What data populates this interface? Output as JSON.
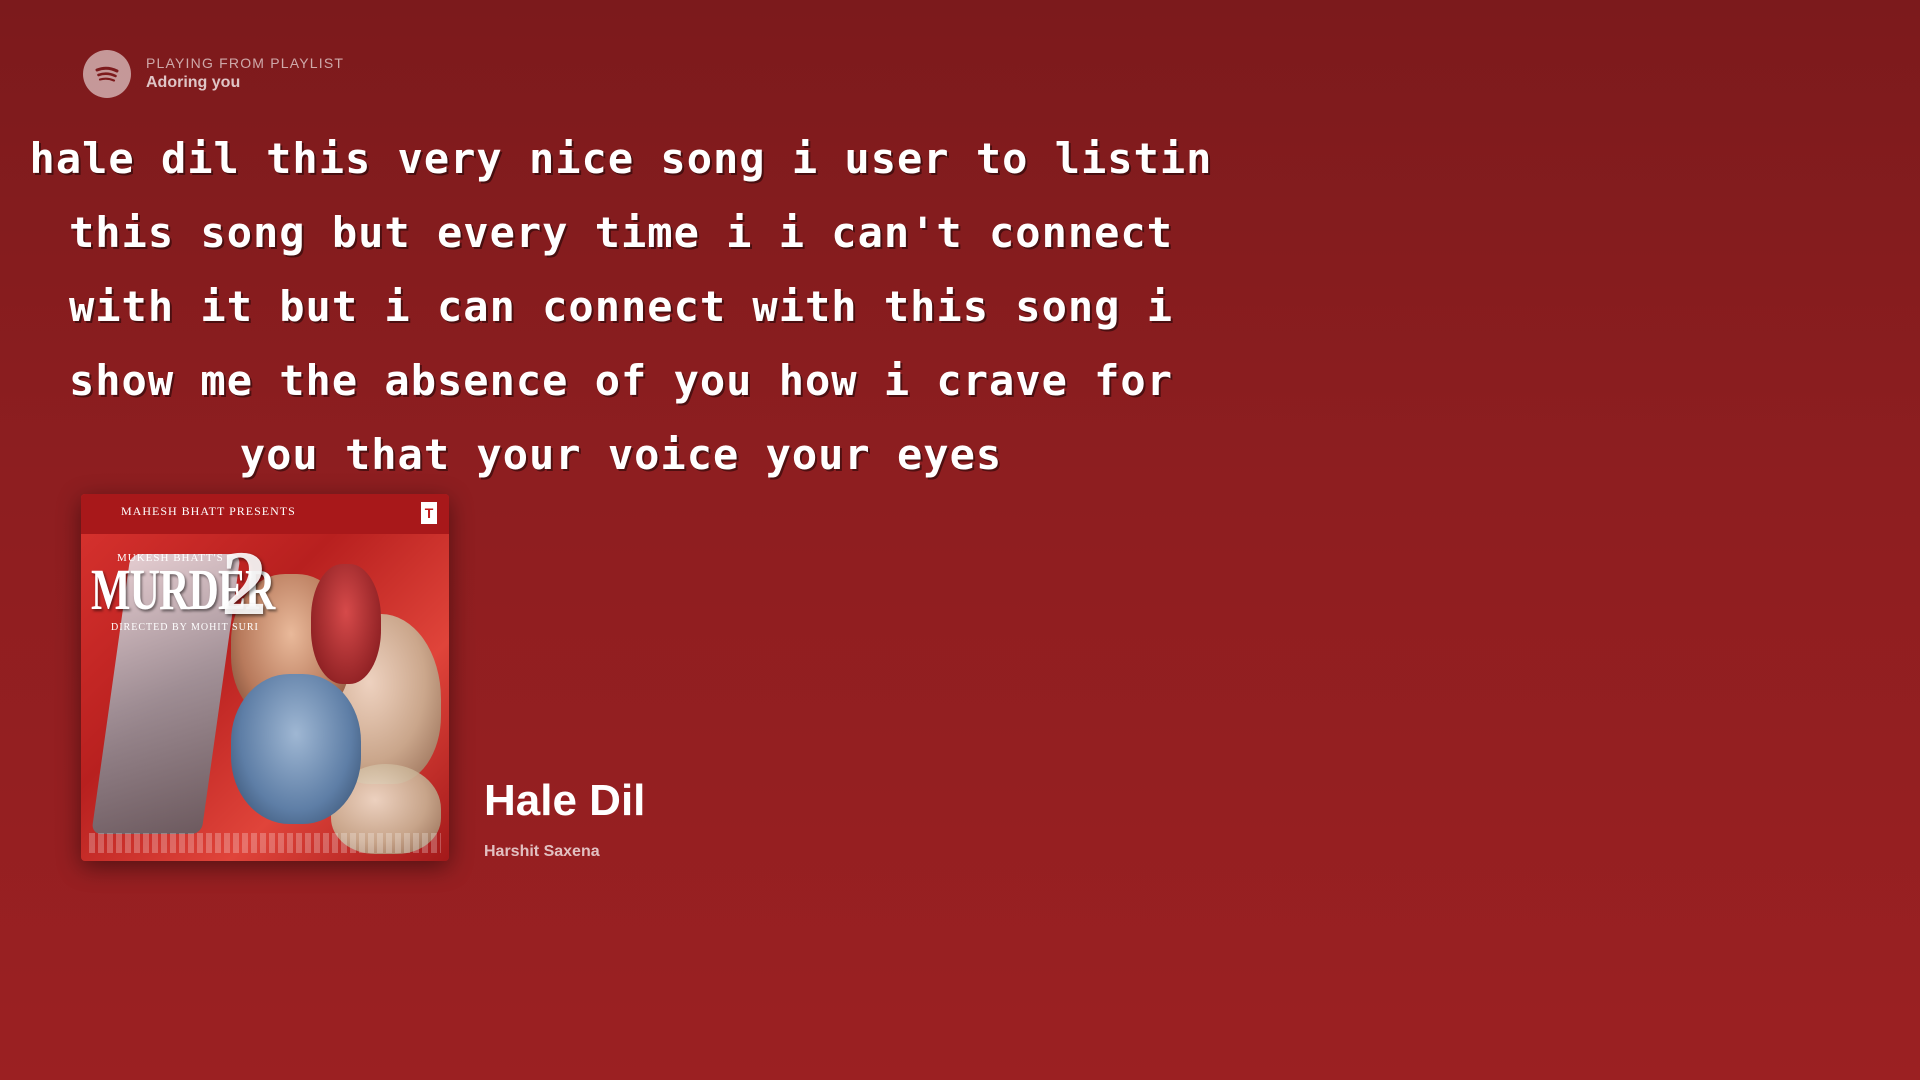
{
  "header": {
    "context_label": "PLAYING FROM PLAYLIST",
    "playlist_name": "Adoring you",
    "logo_icon": "spotify-icon"
  },
  "lyrics": {
    "text": "hale dil this very nice song i user to listin this song but every time i i can't connect with it but i can connect with this song i show me the absence of you how i crave for you that your voice your eyes"
  },
  "album_art": {
    "presents": "MAHESH BHATT PRESENTS",
    "subtitle": "MUKESH BHATT'S",
    "title": "MURDER",
    "number": "2",
    "director": "DIRECTED BY MOHIT SURI",
    "label_logo": "T"
  },
  "track": {
    "title": "Hale Dil",
    "artist": "Harshit Saxena"
  },
  "colors": {
    "background_top": "#7c1a1c",
    "background_bottom": "#9b2022",
    "text_primary": "#ffffff"
  }
}
